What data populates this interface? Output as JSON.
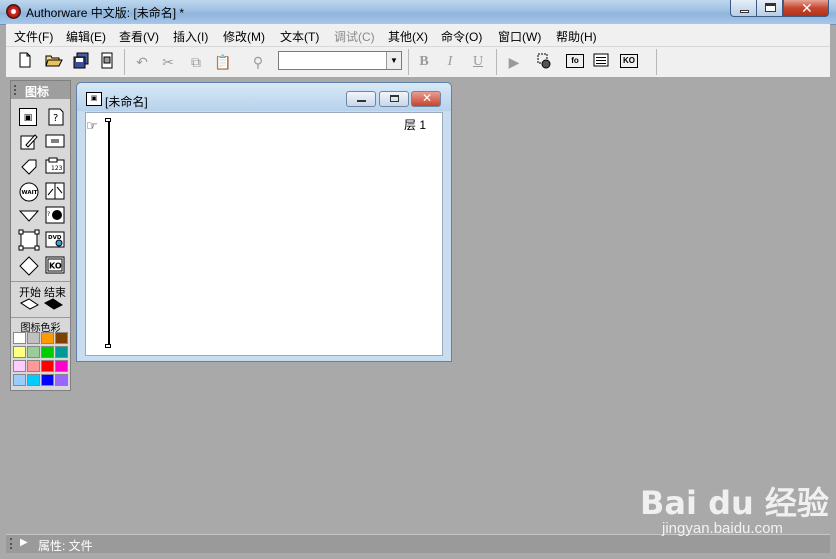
{
  "window": {
    "title": "Authorware 中文版: [未命名] *"
  },
  "menu": [
    "文件(F)",
    "编辑(E)",
    "查看(V)",
    "插入(I)",
    "修改(M)",
    "文本(T)",
    "调试(C)",
    "其他(X)",
    "命令(O)",
    "窗口(W)",
    "帮助(H)"
  ],
  "menu_disabled": [
    "调试(C)"
  ],
  "toolbar": {
    "font_select_value": "",
    "bold": "B",
    "italic": "I",
    "underline": "U",
    "fo_label": "fo",
    "ko_label": "KO",
    "buttons": [
      "new-icon",
      "open-icon",
      "save-all-icon",
      "import-icon",
      "undo-icon",
      "cut-icon",
      "copy-icon",
      "paste-icon",
      "find-icon",
      "bold",
      "italic",
      "underline",
      "run-icon",
      "control-panel-icon",
      "functions-icon",
      "variables-icon",
      "knowledge-objects-icon"
    ]
  },
  "palette": {
    "title": "图标",
    "icons": [
      "display-icon",
      "motion-icon",
      "erase-icon",
      "wait-icon",
      "navigate-icon",
      "framework-icon",
      "decision-icon",
      "interaction-icon",
      "calculation-icon",
      "map-icon",
      "digital-movie-icon",
      "sound-icon",
      "dvd-icon",
      "knowledge-object-icon"
    ],
    "wait_text": "WAIT",
    "dvd_text": "DVD",
    "ko_text": "KO",
    "start_label": "开始",
    "end_label": "结束",
    "colors_label": "图标色彩",
    "colors": [
      "#ffffff",
      "#c0c0c0",
      "#ff9900",
      "#804000",
      "#ffff80",
      "#99cc99",
      "#00cc00",
      "#009999",
      "#ffccff",
      "#ff9999",
      "#ff0000",
      "#ff00cc",
      "#99ccff",
      "#00ccff",
      "#0000ff",
      "#9966ff"
    ]
  },
  "design_window": {
    "title": "[未命名]",
    "layer_label": "层 1"
  },
  "statusbar": {
    "label": "属性: 文件"
  },
  "watermark": {
    "logo": "Bai du 经验",
    "url": "jingyan.baidu.com"
  }
}
